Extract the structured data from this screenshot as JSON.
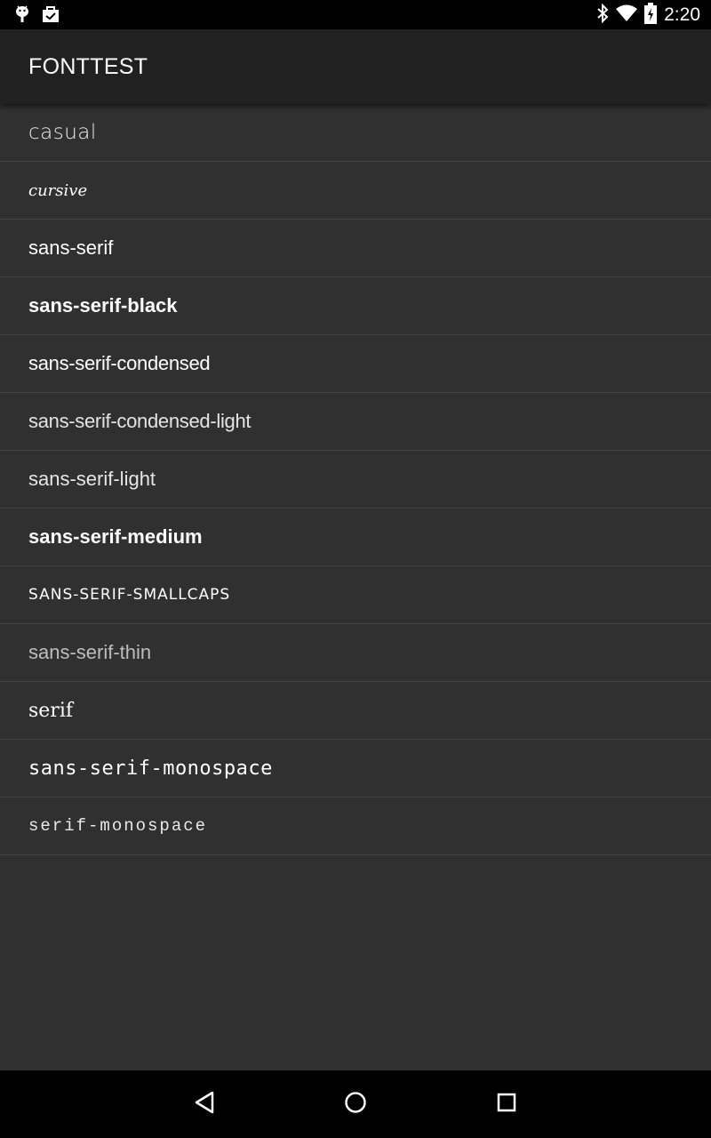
{
  "status_bar": {
    "time": "2:20",
    "left_icons": [
      "android-debug-icon",
      "store-bag-icon"
    ],
    "right_icons": [
      "bluetooth-icon",
      "wifi-icon",
      "battery-charging-icon"
    ]
  },
  "app_bar": {
    "title": "FONTTEST"
  },
  "font_list": [
    "casual",
    "cursive",
    "sans-serif",
    "sans-serif-black",
    "sans-serif-condensed",
    "sans-serif-condensed-light",
    "sans-serif-light",
    "sans-serif-medium",
    "SANS-SERIF-SMALLCAPS",
    "sans-serif-thin",
    "serif",
    "sans-serif-monospace",
    "serif-monospace"
  ],
  "nav_bar": {
    "buttons": [
      "back-icon",
      "home-icon",
      "recents-icon"
    ]
  },
  "colors": {
    "background": "#303030",
    "app_bar": "#212121",
    "divider": "#434343",
    "text": "#ffffff"
  }
}
